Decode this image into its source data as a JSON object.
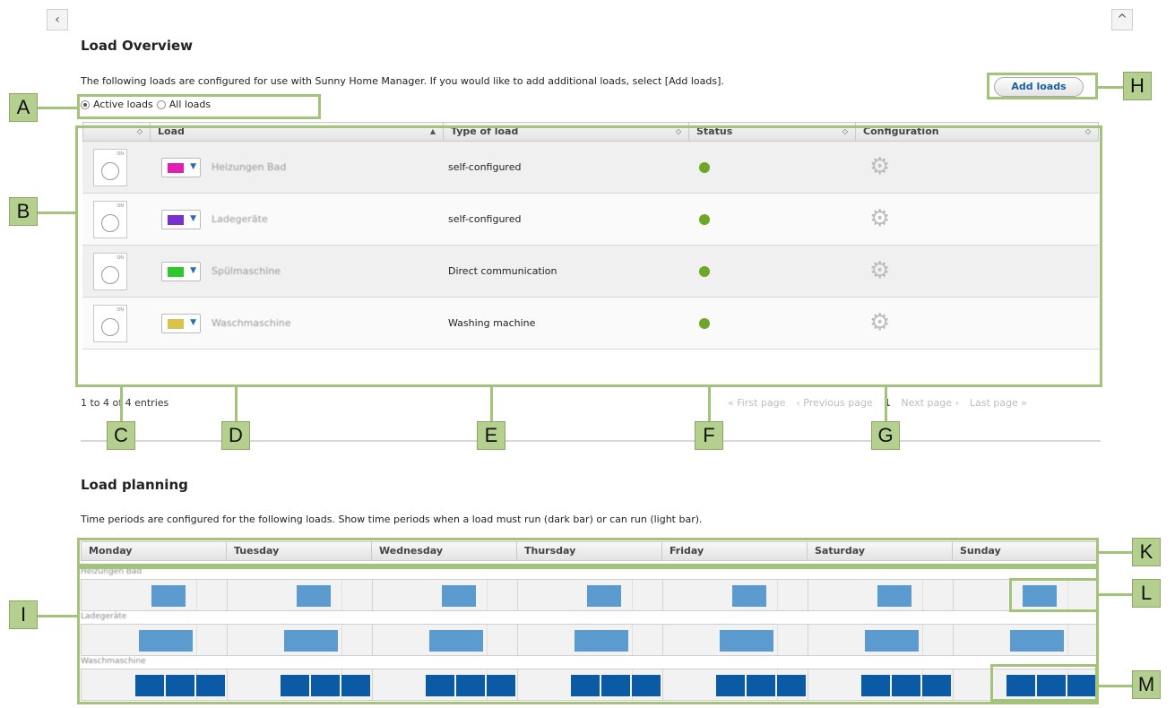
{
  "nav": {
    "back_icon": "chevron-left-icon",
    "back_glyph": "‹",
    "collapse_icon": "chevron-up-icon",
    "collapse_glyph": "^"
  },
  "overview": {
    "title": "Load Overview",
    "description": "The following loads are configured for use with Sunny Home Manager. If you would like to add additional loads, select [Add loads].",
    "add_button": "Add loads",
    "filter": {
      "active_label": "Active loads",
      "all_label": "All loads",
      "selected": "Active loads"
    },
    "columns": [
      "Load",
      "Type of load",
      "Status",
      "Configuration"
    ],
    "rows": [
      {
        "name": "Heizungen Bad",
        "color": "#e020b0",
        "type": "self-configured",
        "status_color": "#6ea626"
      },
      {
        "name": "Ladegeräte",
        "color": "#7a2fcf",
        "type": "self-configured",
        "status_color": "#6ea626"
      },
      {
        "name": "Spülmaschine",
        "color": "#2ec82e",
        "type": "Direct communication",
        "status_color": "#6ea626"
      },
      {
        "name": "Waschmaschine",
        "color": "#d9c24a",
        "type": "Washing machine",
        "status_color": "#6ea626"
      }
    ],
    "entries": "1 to 4 of 4 entries",
    "pager": {
      "first": "« First page",
      "prev": "‹ Previous page",
      "current": "1",
      "next": "Next page ›",
      "last": "Last page »"
    }
  },
  "planning": {
    "title": "Load planning",
    "description": "Time periods are configured for the following loads. Show time periods when a load must run (dark bar) or can run (light bar).",
    "days": [
      "Monday",
      "Tuesday",
      "Wednesday",
      "Thursday",
      "Friday",
      "Saturday",
      "Sunday"
    ],
    "loads": [
      "Heizungen Bad",
      "Ladegeräte",
      "Waschmaschine"
    ],
    "colors": {
      "must_run": "#0b5aa6",
      "can_run": "#5b9bcf"
    }
  },
  "annotations": [
    "A",
    "B",
    "C",
    "D",
    "E",
    "F",
    "G",
    "H",
    "I",
    "K",
    "L",
    "M"
  ]
}
